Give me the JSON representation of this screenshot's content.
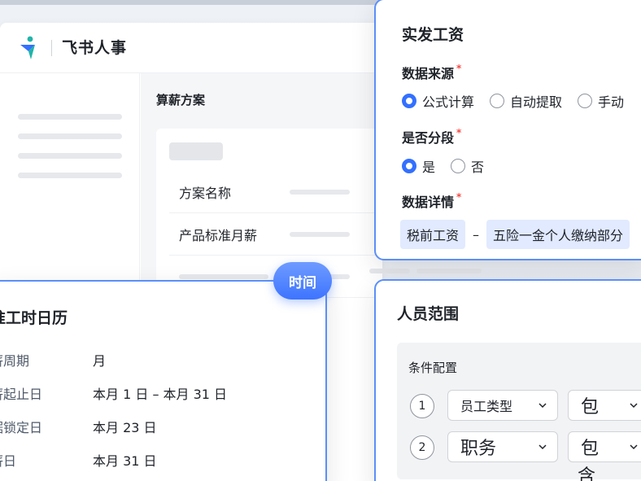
{
  "app": {
    "brand_name": "飞书人事",
    "page_title": "算薪方案",
    "form_rows": [
      {
        "label": "方案名称"
      },
      {
        "label": "产品标准月薪"
      }
    ]
  },
  "salary_panel": {
    "title": "实发工资",
    "source": {
      "label": "数据来源",
      "required_mark": "*",
      "options": [
        {
          "label": "公式计算",
          "selected": true
        },
        {
          "label": "自动提取",
          "selected": false
        },
        {
          "label": "手动",
          "selected": false
        }
      ]
    },
    "segment": {
      "label": "是否分段",
      "required_mark": "*",
      "options": [
        {
          "label": "是",
          "selected": true
        },
        {
          "label": "否",
          "selected": false
        }
      ]
    },
    "details": {
      "label": "数据详情",
      "required_mark": "*",
      "chips": [
        "税前工资",
        "五险一金个人缴纳部分"
      ],
      "operator": "–"
    }
  },
  "calendar_panel": {
    "badge": "时间",
    "title": "准工时日历",
    "rows": [
      {
        "key": "薪周期",
        "value": "月"
      },
      {
        "key": "薪起止日",
        "value": "本月 1 日 – 本月 31 日"
      },
      {
        "key": "据锁定日",
        "value": "本月 23 日"
      },
      {
        "key": "薪日",
        "value": "本月 31 日"
      }
    ]
  },
  "range_panel": {
    "title": "人员范围",
    "condition_title": "条件配置",
    "conditions": [
      {
        "index": "1",
        "field": "员工类型",
        "operator": "包"
      },
      {
        "index": "2",
        "field": "职务",
        "operator": "包"
      }
    ],
    "overflow_text": "含"
  },
  "colors": {
    "accent": "#3370ff",
    "panel_border": "#5b8ff9",
    "chip_bg": "#e1eaff",
    "required": "#f54a45"
  },
  "icons": {
    "brand": "feishu-logo-icon",
    "select": "chevron-down-icon"
  }
}
